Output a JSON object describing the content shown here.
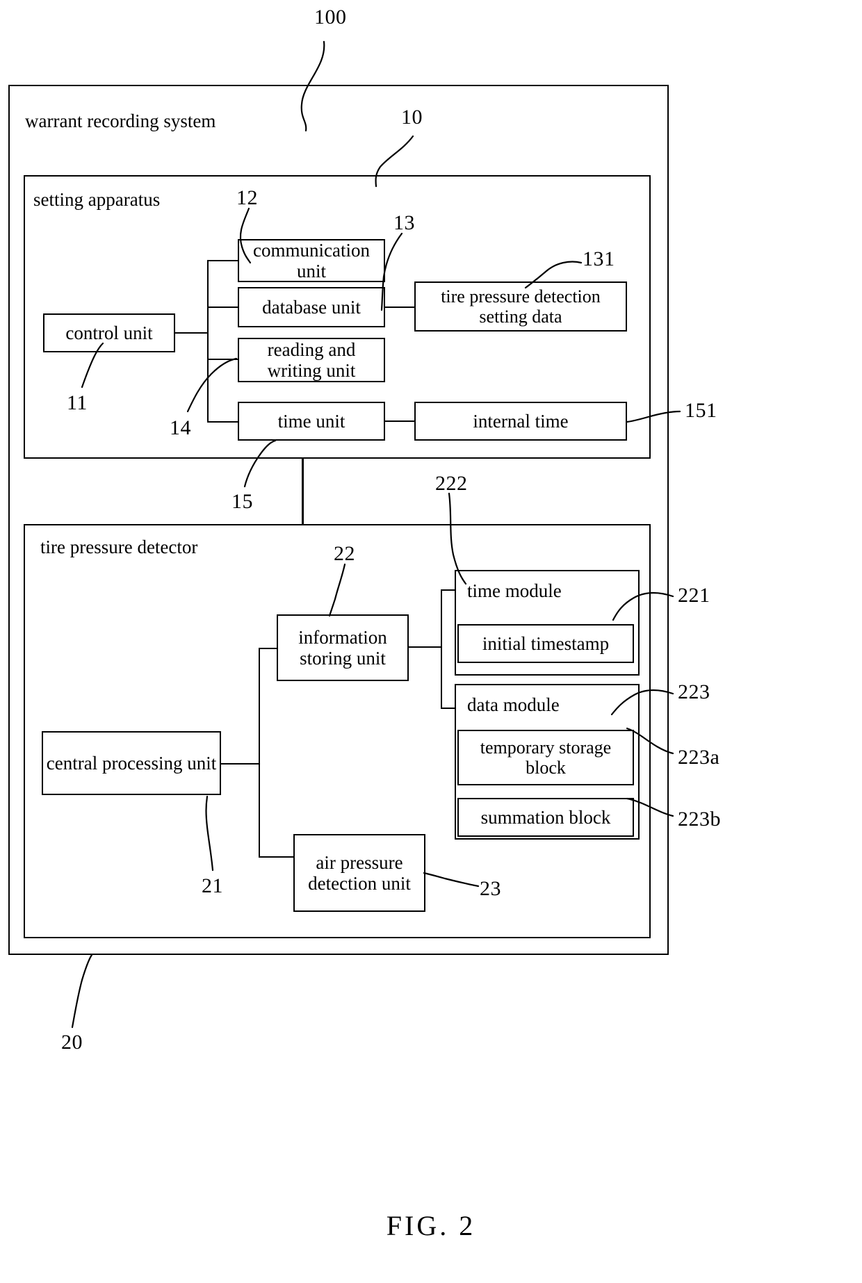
{
  "figure": {
    "caption": "FIG. 2",
    "system_title": "warrant recording system",
    "system_ref": "100"
  },
  "setting_apparatus": {
    "title": "setting apparatus",
    "ref": "10",
    "blocks": {
      "control_unit": {
        "label": "control unit",
        "ref": "11"
      },
      "communication_unit": {
        "label": "communication unit",
        "ref": "12"
      },
      "database_unit": {
        "label": "database unit",
        "ref": "13"
      },
      "reading_writing_unit": {
        "label": "reading and writing unit",
        "ref": "14"
      },
      "time_unit": {
        "label": "time unit",
        "ref": "15"
      },
      "tire_pressure_setting_data": {
        "label": "tire pressure detection setting data",
        "ref": "131"
      },
      "internal_time": {
        "label": "internal time",
        "ref": "151"
      }
    }
  },
  "tire_pressure_detector": {
    "title": "tire pressure detector",
    "ref": "20",
    "blocks": {
      "central_processing_unit": {
        "label": "central processing unit",
        "ref": "21"
      },
      "information_storing_unit": {
        "label": "information storing unit",
        "ref": "22"
      },
      "air_pressure_detection_unit": {
        "label": "air pressure detection unit",
        "ref": "23"
      },
      "time_module": {
        "label": "time module",
        "ref": "222"
      },
      "initial_timestamp": {
        "label": "initial timestamp",
        "ref": "221"
      },
      "data_module": {
        "label": "data module",
        "ref": "223"
      },
      "temporary_storage_block": {
        "label": "temporary storage block",
        "ref": "223a"
      },
      "summation_block": {
        "label": "summation block",
        "ref": "223b"
      }
    }
  }
}
